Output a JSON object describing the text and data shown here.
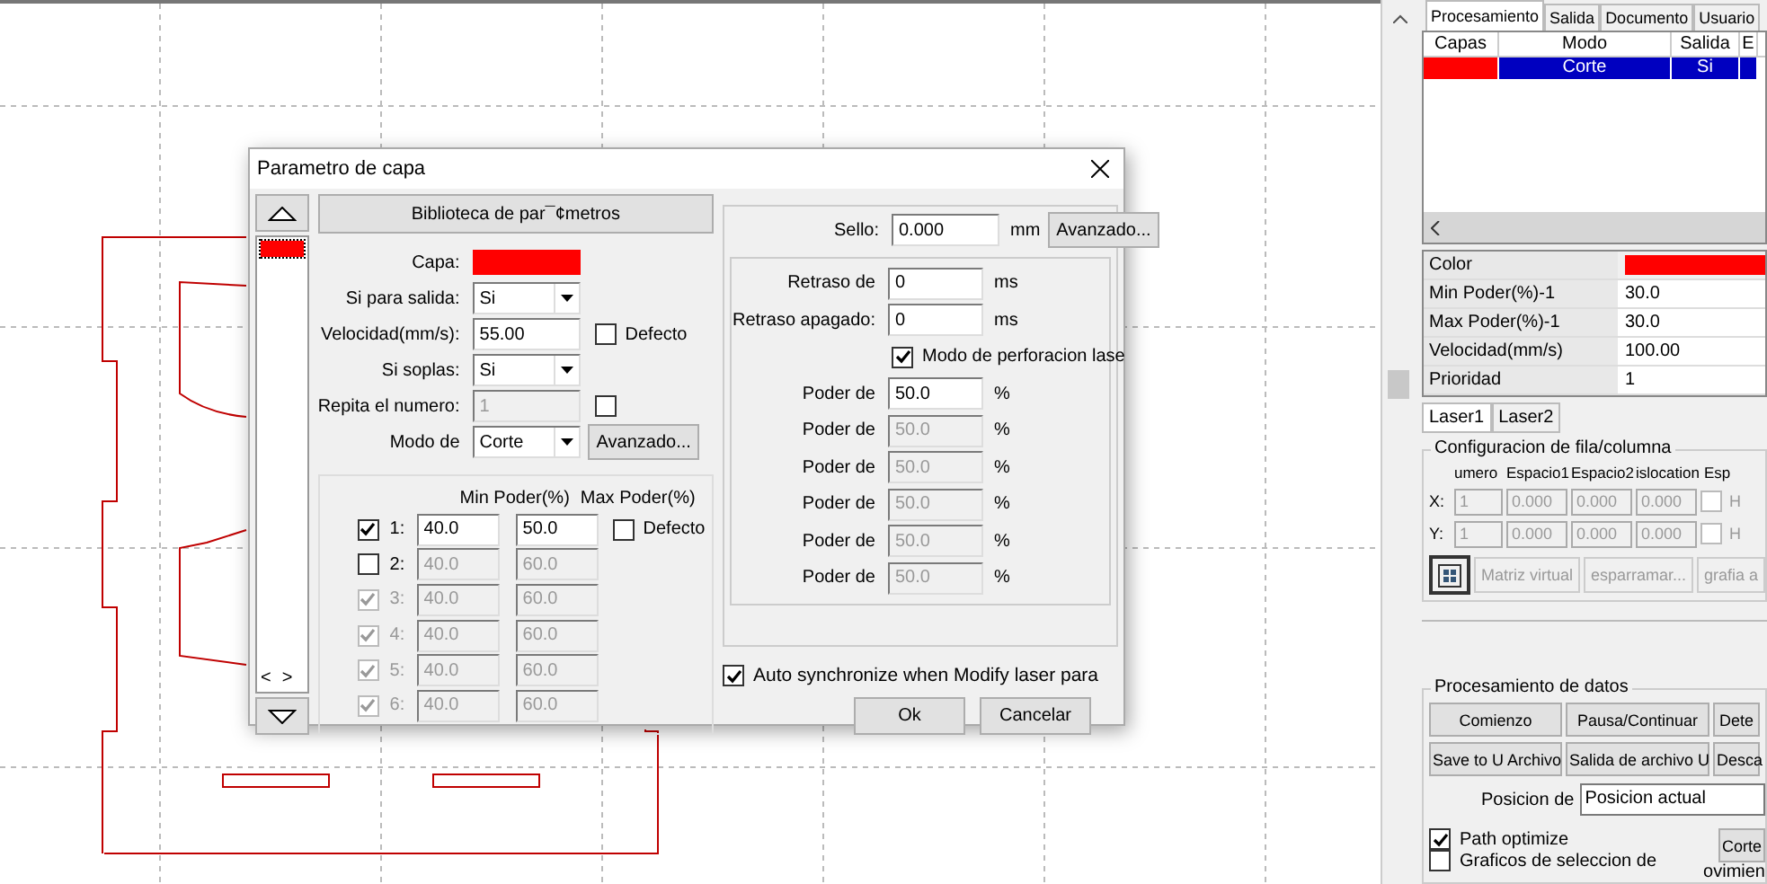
{
  "dialog": {
    "title": "Parametro de capa",
    "library_button": "Biblioteca de par¯¢metros",
    "layers": [
      {
        "color": "#ff0000",
        "selected": true
      }
    ],
    "nav_arrows": [
      "<",
      ">"
    ],
    "form": [
      {
        "kind": "color",
        "label": "Capa:",
        "color": "#ff0000"
      },
      {
        "kind": "select",
        "label": "Si para salida:",
        "value": "Si"
      },
      {
        "kind": "input",
        "label": "Velocidad(mm/s):",
        "value": "55.00",
        "disabled": false,
        "check": {
          "label": "Defecto",
          "checked": false
        }
      },
      {
        "kind": "select",
        "label": "Si soplas:",
        "value": "Si"
      },
      {
        "kind": "input",
        "label": "Repita el numero:",
        "value": "1",
        "disabled": true,
        "check": {
          "checked": false
        }
      },
      {
        "kind": "select",
        "label": "Modo de",
        "value": "Corte",
        "button": "Avanzado..."
      }
    ],
    "power": {
      "columns": [
        "Min Poder(%)",
        "Max Poder(%)"
      ],
      "default": {
        "label": "Defecto",
        "checked": false
      },
      "rows": [
        {
          "label": "1:",
          "checked": true,
          "disabled": false,
          "min": "40.0",
          "max": "50.0"
        },
        {
          "label": "2:",
          "checked": false,
          "disabled": false,
          "min": "40.0",
          "max": "60.0"
        },
        {
          "label": "3:",
          "checked": true,
          "disabled": true,
          "min": "40.0",
          "max": "60.0"
        },
        {
          "label": "4:",
          "checked": true,
          "disabled": true,
          "min": "40.0",
          "max": "60.0"
        },
        {
          "label": "5:",
          "checked": true,
          "disabled": true,
          "min": "40.0",
          "max": "60.0"
        },
        {
          "label": "6:",
          "checked": true,
          "disabled": true,
          "min": "40.0",
          "max": "60.0"
        }
      ]
    },
    "sello": {
      "label": "Sello:",
      "value": "0.000",
      "unit": "mm",
      "button": "Avanzado..."
    },
    "delays": [
      {
        "label": "Retraso de",
        "value": "0",
        "unit": "ms"
      },
      {
        "label": "Retraso apagado:",
        "value": "0",
        "unit": "ms"
      }
    ],
    "perforation": {
      "label": "Modo de perforacion lase",
      "checked": true
    },
    "pierce_powers": [
      {
        "label": "Poder de",
        "value": "50.0",
        "unit": "%",
        "disabled": false
      },
      {
        "label": "Poder de",
        "value": "50.0",
        "unit": "%",
        "disabled": true
      },
      {
        "label": "Poder de",
        "value": "50.0",
        "unit": "%",
        "disabled": true
      },
      {
        "label": "Poder de",
        "value": "50.0",
        "unit": "%",
        "disabled": true
      },
      {
        "label": "Poder de",
        "value": "50.0",
        "unit": "%",
        "disabled": true
      },
      {
        "label": "Poder de",
        "value": "50.0",
        "unit": "%",
        "disabled": true
      }
    ],
    "auto_sync": {
      "label": "Auto synchronize when Modify laser para",
      "checked": true
    },
    "buttons": [
      "Ok",
      "Cancelar"
    ]
  },
  "panel": {
    "tabs": [
      {
        "label": "Procesamiento",
        "selected": true
      },
      {
        "label": "Salida",
        "selected": false
      },
      {
        "label": "Documento",
        "selected": false
      },
      {
        "label": "Usuario",
        "selected": false
      }
    ],
    "layer_table": {
      "columns": [
        "Capas",
        "Modo",
        "Salida",
        "E"
      ],
      "rows": [
        {
          "color": "#ff0000",
          "mode": "Corte",
          "output": "Si",
          "selected": true
        }
      ]
    },
    "properties": [
      {
        "kind": "color",
        "label": "Color",
        "color": "#ff0000"
      },
      {
        "kind": "text",
        "label": "Min Poder(%)-1",
        "value": "30.0"
      },
      {
        "kind": "text",
        "label": "Max Poder(%)-1",
        "value": "30.0"
      },
      {
        "kind": "text",
        "label": "Velocidad(mm/s)",
        "value": "100.00"
      },
      {
        "kind": "text",
        "label": "Prioridad",
        "value": "1"
      }
    ],
    "laser_tabs": [
      {
        "label": "Laser1",
        "selected": true
      },
      {
        "label": "Laser2",
        "selected": false
      }
    ],
    "array_group": {
      "title": "Configuracion de fila/columna",
      "columns": [
        "umero",
        "Espacio1",
        "Espacio2",
        "islocation",
        "Esp"
      ],
      "rows": [
        {
          "axis": "X:",
          "values": [
            "1",
            "0.000",
            "0.000",
            "0.000"
          ],
          "check": {
            "label": "H",
            "checked": false
          }
        },
        {
          "axis": "Y:",
          "values": [
            "1",
            "0.000",
            "0.000",
            "0.000"
          ],
          "check": {
            "label": "H",
            "checked": false
          }
        }
      ],
      "buttons": [
        "Matriz virtual",
        "esparramar...",
        "grafia a"
      ]
    },
    "data_group": {
      "title": "Procesamiento de datos",
      "button_rows": [
        [
          "Comienzo",
          "Pausa/Continuar",
          "Dete"
        ],
        [
          "Save to U Archivo",
          "Salida de archivo U",
          "Desca"
        ]
      ],
      "position": {
        "label": "Posicion de",
        "value": "Posicion actual"
      },
      "options": [
        {
          "label": "Path optimize",
          "checked": true
        },
        {
          "label": "Graficos de seleccion de",
          "checked": false
        }
      ],
      "side_button": "Corte",
      "side_text": "ovimien"
    }
  }
}
